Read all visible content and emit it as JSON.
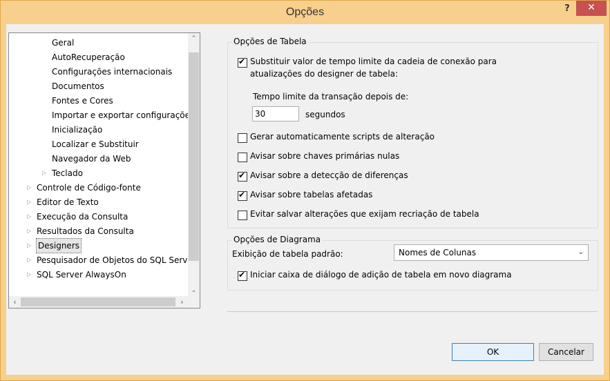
{
  "window": {
    "title": "Opções",
    "help_label": "?",
    "close_label": "✕"
  },
  "tree": {
    "items": [
      {
        "label": "Geral",
        "level": 2,
        "expander": ""
      },
      {
        "label": "AutoRecuperação",
        "level": 2,
        "expander": ""
      },
      {
        "label": "Configurações internacionais",
        "level": 2,
        "expander": ""
      },
      {
        "label": "Documentos",
        "level": 2,
        "expander": ""
      },
      {
        "label": "Fontes e Cores",
        "level": 2,
        "expander": ""
      },
      {
        "label": "Importar e exportar configurações",
        "level": 2,
        "expander": ""
      },
      {
        "label": "Inicialização",
        "level": 2,
        "expander": ""
      },
      {
        "label": "Localizar e Substituir",
        "level": 2,
        "expander": ""
      },
      {
        "label": "Navegador da Web",
        "level": 2,
        "expander": ""
      },
      {
        "label": "Teclado",
        "level": 2,
        "expander": "▷"
      },
      {
        "label": "Controle de Código-fonte",
        "level": 1,
        "expander": "▷"
      },
      {
        "label": "Editor de Texto",
        "level": 1,
        "expander": "▷"
      },
      {
        "label": "Execução da Consulta",
        "level": 1,
        "expander": "▷"
      },
      {
        "label": "Resultados da Consulta",
        "level": 1,
        "expander": "▷"
      },
      {
        "label": "Designers",
        "level": 1,
        "expander": "▷",
        "selected": true
      },
      {
        "label": "Pesquisador de Objetos do SQL Serve",
        "level": 1,
        "expander": "▷"
      },
      {
        "label": "SQL Server AlwaysOn",
        "level": 1,
        "expander": "▷"
      }
    ],
    "scroll_up": "⌃",
    "scroll_down": "⌄",
    "scroll_left": "‹",
    "scroll_right": "›"
  },
  "table_options": {
    "title": "Opções de Tabela",
    "override_timeout": {
      "label_line1": "Substituir valor de tempo limite da cadeia de conexão para",
      "label_line2": "atualizações do designer de tabela:",
      "checked": true
    },
    "timeout_label": "Tempo limite da transação depois de:",
    "timeout_value": "30",
    "timeout_unit": "segundos",
    "auto_scripts": {
      "label": "Gerar automaticamente scripts de alteração",
      "checked": false
    },
    "warn_null_pk": {
      "label": "Avisar sobre chaves primárias nulas",
      "checked": false
    },
    "warn_diff": {
      "label": "Avisar sobre a detecção de diferenças",
      "checked": true
    },
    "warn_affected": {
      "label": "Avisar sobre tabelas afetadas",
      "checked": true
    },
    "prevent_saving": {
      "label": "Evitar salvar alterações que exijam recriação de tabela",
      "checked": false
    }
  },
  "diagram_options": {
    "title": "Opções de Diagrama",
    "default_view_label": "Exibição de tabela padrão:",
    "default_view_value": "Nomes de Colunas",
    "launch_add_table": {
      "label": "Iniciar caixa de diálogo de adição de tabela em novo diagrama",
      "checked": true
    }
  },
  "buttons": {
    "ok": "OK",
    "cancel": "Cancelar"
  }
}
